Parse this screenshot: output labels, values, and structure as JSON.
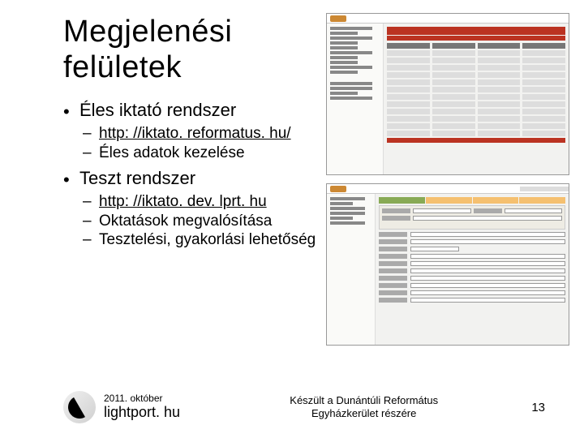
{
  "title_l1": "Megjelenési",
  "title_l2": "felületek",
  "bullets": {
    "b1": "Éles iktató rendszer",
    "b1s1": "http: //iktato. reformatus. hu/",
    "b1s2": "Éles adatok kezelése",
    "b2": "Teszt rendszer",
    "b2s1": "http: //iktato. dev. lprt. hu",
    "b2s2": "Oktatások megvalósítása",
    "b2s3": "Tesztelési, gyakorlási lehetőség"
  },
  "footer": {
    "date": "2011. október",
    "brand": "lightport. hu",
    "mid_l1": "Készült a Dunántúli Református",
    "mid_l2": "Egyházkerület részére",
    "page": "13"
  }
}
